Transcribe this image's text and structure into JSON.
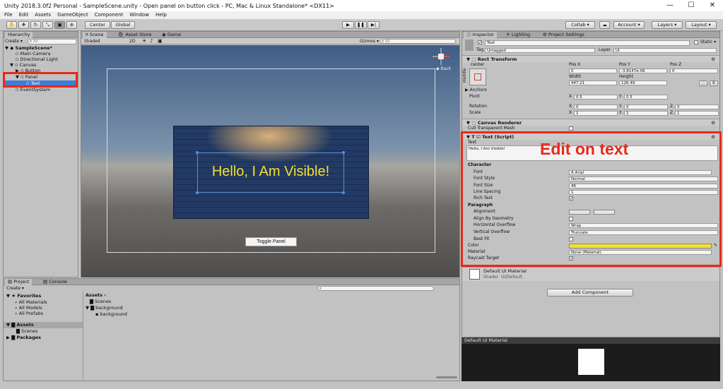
{
  "window": {
    "title": "Unity 2018.3.0f2 Personal - SampleScene.unity - Open panel on button click - PC, Mac & Linux Standalone* <DX11>",
    "min": "—",
    "max": "☐",
    "close": "✕"
  },
  "menu": [
    "File",
    "Edit",
    "Assets",
    "GameObject",
    "Component",
    "Window",
    "Help"
  ],
  "toolbar": {
    "center": "Center",
    "global": "Global",
    "collab": "Collab ▾",
    "account": "Account ▾",
    "layers": "Layers ▾",
    "layout": "Layout ▾",
    "cloud": "☁"
  },
  "hierarchy": {
    "tab": "Hierarchy",
    "create": "Create ▾",
    "search_placeholder": "All",
    "scene": "SampleScene*",
    "items": [
      "Main Camera",
      "Directional Light",
      "Canvas",
      "Button",
      "Panel",
      "Text",
      "EventSystem"
    ]
  },
  "scene_view": {
    "tabs": [
      "Scene",
      "Asset Store",
      "Game"
    ],
    "shading": "Shaded",
    "mode2d": "2D",
    "gizmos": "Gizmos ▾",
    "search_placeholder": "All",
    "back_label": "Back",
    "panel_text": "Hello, I Am Visible!",
    "toggle_button": "Toggle  Panel"
  },
  "inspector": {
    "tabs": [
      "Inspector",
      "Lighting",
      "Project Settings"
    ],
    "object_name": "Text",
    "static": "Static ▾",
    "tag_label": "Tag",
    "tag": "Untagged",
    "layer_label": "Layer",
    "layer": "UI",
    "rect_transform": {
      "title": "Rect Transform",
      "anchor": "center",
      "side": "middle",
      "posx_l": "Pos X",
      "posy_l": "Pos Y",
      "posz_l": "Pos Z",
      "posx": "0",
      "posy": "-3.8147e-06",
      "posz": "0",
      "width_l": "Width",
      "height_l": "Height",
      "width": "447.21",
      "height": "126.49",
      "anchors": "Anchors",
      "pivot": "Pivot",
      "px": "0.5",
      "py": "0.5",
      "rotation": "Rotation",
      "rx": "0",
      "ry": "0",
      "rz": "0",
      "scale": "Scale",
      "sx": "1",
      "sy": "1",
      "sz": "1",
      "r": "R",
      "x": "X",
      "y": "Y",
      "z": "Z"
    },
    "canvas_renderer": {
      "title": "Canvas Renderer",
      "cull": "Cull Transparent Mesh"
    },
    "text_script": {
      "title": "Text (Script)",
      "text_label": "Text",
      "text_value": "Hello, I Am Visible!",
      "character": "Character",
      "font_l": "Font",
      "font": "Arial",
      "style_l": "Font Style",
      "style": "Normal",
      "size_l": "Font Size",
      "size": "46",
      "spacing_l": "Line Spacing",
      "spacing": "1",
      "rich_l": "Rich Text",
      "paragraph": "Paragraph",
      "align_l": "Alignment",
      "geom_l": "Align By Geometry",
      "hover_l": "Horizontal Overflow",
      "hover": "Wrap",
      "vover_l": "Vertical Overflow",
      "vover": "Truncate",
      "best_l": "Best Fit",
      "color_l": "Color",
      "material_l": "Material",
      "material": "None (Material)",
      "raycast_l": "Raycast Target",
      "color": "#f5e12c"
    },
    "material": {
      "name": "Default UI Material",
      "shader_l": "Shader",
      "shader": "UI/Default"
    },
    "add_component": "Add Component",
    "annotation": "Edit on text",
    "preview_title": "Default UI Material"
  },
  "project": {
    "tabs": [
      "Project",
      "Console"
    ],
    "create": "Create ▾",
    "favorites": "Favorites",
    "fav_items": [
      "All Materials",
      "All Models",
      "All Prefabs"
    ],
    "assets": "Assets",
    "asset_children": [
      "Scenes"
    ],
    "packages": "Packages",
    "breadcrumb": "Assets ›",
    "files": [
      "Scenes",
      "background",
      "background"
    ]
  },
  "colors": {
    "accent": "#3d7dd8",
    "annotation": "#e8291b"
  }
}
